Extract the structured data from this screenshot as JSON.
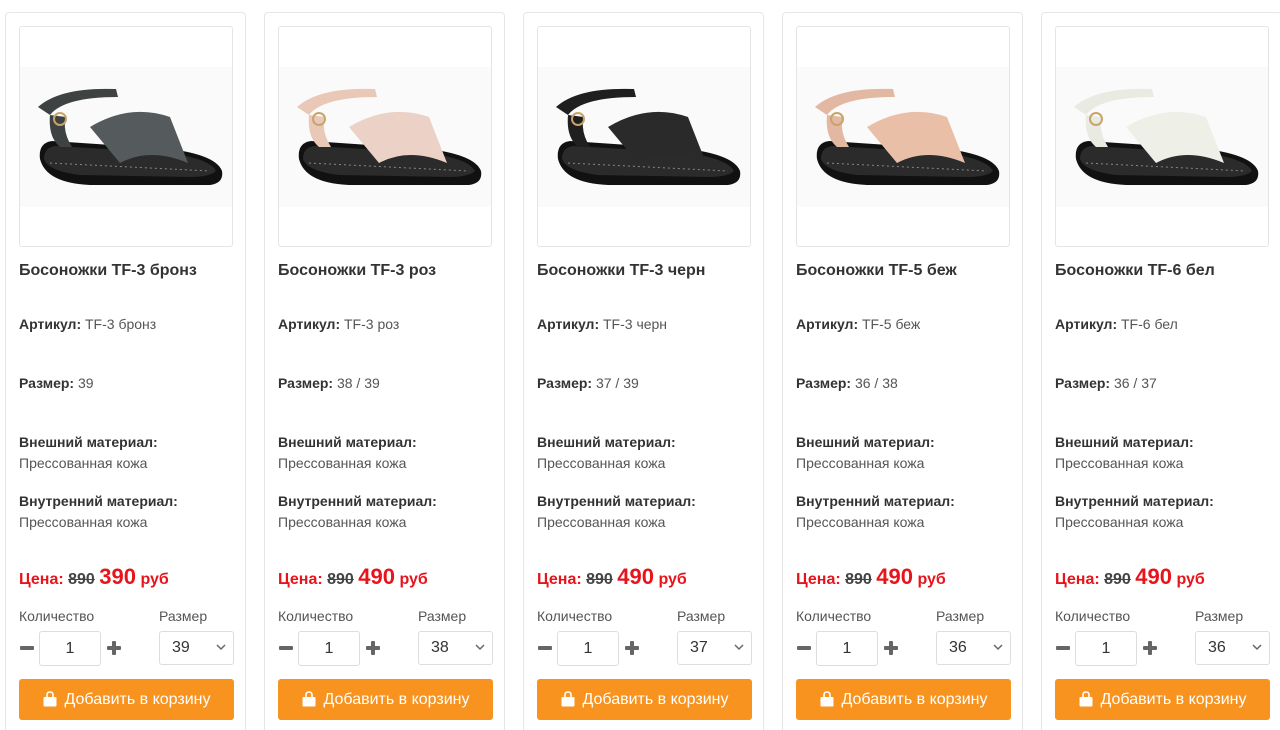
{
  "labels": {
    "article": "Артикул:",
    "size": "Размер:",
    "outer_material": "Внешний материал:",
    "inner_material": "Внутренний материал:",
    "price": "Цена:",
    "currency": "руб",
    "quantity": "Количество",
    "size_select": "Размер",
    "add_to_cart": "Добавить в корзину"
  },
  "colors": {
    "accent": "#f7931e",
    "price": "#e8141b"
  },
  "products": [
    {
      "title": "Босоножки TF-3 бронз",
      "article": "TF-3 бронз",
      "sizes": "39",
      "outer": "Прессованная кожа",
      "inner": "Прессованная кожа",
      "old_price": "890",
      "new_price": "390",
      "qty": "1",
      "selected_size": "39",
      "strap": "#3f4243",
      "front": "#555a5c"
    },
    {
      "title": "Босоножки TF-3 роз",
      "article": "TF-3 роз",
      "sizes": "38 / 39",
      "outer": "Прессованная кожа",
      "inner": "Прессованная кожа",
      "old_price": "890",
      "new_price": "490",
      "qty": "1",
      "selected_size": "38",
      "strap": "#e9c8b8",
      "front": "#ecd2c6"
    },
    {
      "title": "Босоножки TF-3 черн",
      "article": "TF-3 черн",
      "sizes": "37 / 39",
      "outer": "Прессованная кожа",
      "inner": "Прессованная кожа",
      "old_price": "890",
      "new_price": "490",
      "qty": "1",
      "selected_size": "37",
      "strap": "#1f1f1f",
      "front": "#2a2a2a"
    },
    {
      "title": "Босоножки TF-5 беж",
      "article": "TF-5 беж",
      "sizes": "36 / 38",
      "outer": "Прессованная кожа",
      "inner": "Прессованная кожа",
      "old_price": "890",
      "new_price": "490",
      "qty": "1",
      "selected_size": "36",
      "strap": "#e2b8a2",
      "front": "#e9bfa8"
    },
    {
      "title": "Босоножки TF-6 бел",
      "article": "TF-6 бел",
      "sizes": "36 / 37",
      "outer": "Прессованная кожа",
      "inner": "Прессованная кожа",
      "old_price": "890",
      "new_price": "490",
      "qty": "1",
      "selected_size": "36",
      "strap": "#e9eae2",
      "front": "#eef0e8"
    }
  ]
}
